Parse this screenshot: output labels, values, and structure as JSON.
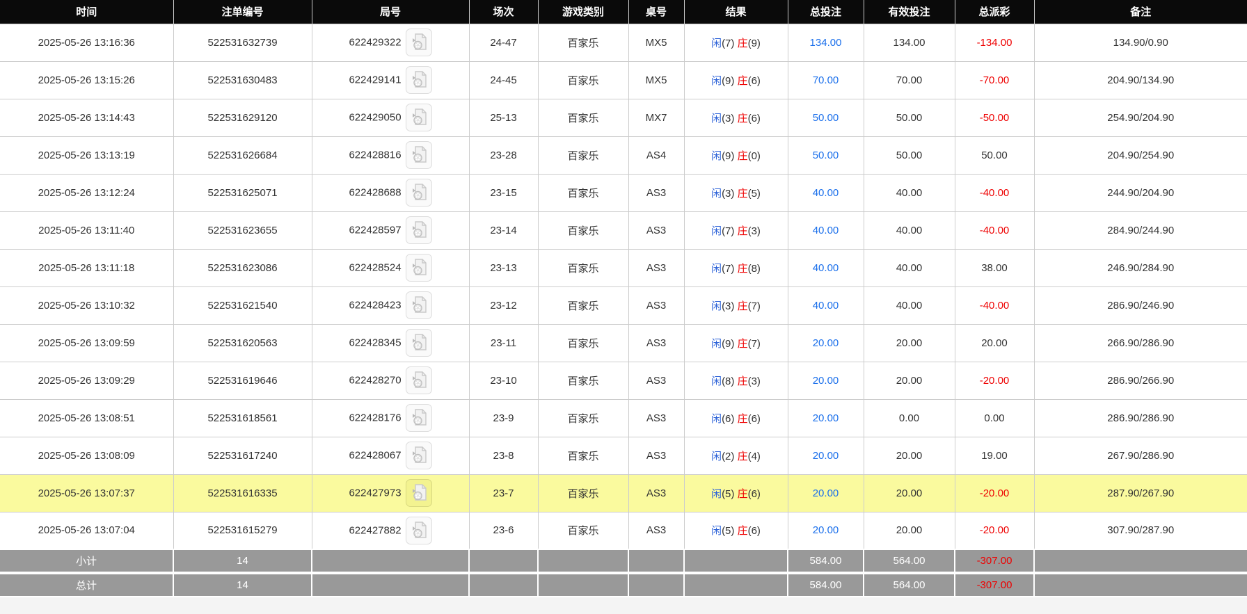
{
  "colors": {
    "header_bg": "#0a0a0a",
    "header_text": "#ffffff",
    "grid_border": "#cccccc",
    "row_text": "#333333",
    "bet_link_blue": "#1a6feb",
    "player_blue": "#2e63d8",
    "banker_red": "#ee0000",
    "negative_red": "#ee0000",
    "highlight_yellow": "#fafa9e",
    "summary_bg": "#999999"
  },
  "table": {
    "columns": [
      "时间",
      "注单编号",
      "局号",
      "场次",
      "游戏类别",
      "桌号",
      "结果",
      "总投注",
      "有效投注",
      "总派彩",
      "备注"
    ],
    "video_icon_name": "film-replay-icon",
    "rows": [
      {
        "time": "2025-05-26 13:16:36",
        "bet_no": "522531632739",
        "round_no": "622429322",
        "session": "24-47",
        "game": "百家乐",
        "table_no": "MX5",
        "result_player": "闲",
        "result_player_score": "(7)",
        "result_banker": "庄",
        "result_banker_score": "(9)",
        "total_bet": "134.00",
        "valid_bet": "134.00",
        "payout": "-134.00",
        "remark": "134.90/0.90",
        "highlighted": false
      },
      {
        "time": "2025-05-26 13:15:26",
        "bet_no": "522531630483",
        "round_no": "622429141",
        "session": "24-45",
        "game": "百家乐",
        "table_no": "MX5",
        "result_player": "闲",
        "result_player_score": "(9)",
        "result_banker": "庄",
        "result_banker_score": "(6)",
        "total_bet": "70.00",
        "valid_bet": "70.00",
        "payout": "-70.00",
        "remark": "204.90/134.90",
        "highlighted": false
      },
      {
        "time": "2025-05-26 13:14:43",
        "bet_no": "522531629120",
        "round_no": "622429050",
        "session": "25-13",
        "game": "百家乐",
        "table_no": "MX7",
        "result_player": "闲",
        "result_player_score": "(3)",
        "result_banker": "庄",
        "result_banker_score": "(6)",
        "total_bet": "50.00",
        "valid_bet": "50.00",
        "payout": "-50.00",
        "remark": "254.90/204.90",
        "highlighted": false
      },
      {
        "time": "2025-05-26 13:13:19",
        "bet_no": "522531626684",
        "round_no": "622428816",
        "session": "23-28",
        "game": "百家乐",
        "table_no": "AS4",
        "result_player": "闲",
        "result_player_score": "(9)",
        "result_banker": "庄",
        "result_banker_score": "(0)",
        "total_bet": "50.00",
        "valid_bet": "50.00",
        "payout": "50.00",
        "remark": "204.90/254.90",
        "highlighted": false
      },
      {
        "time": "2025-05-26 13:12:24",
        "bet_no": "522531625071",
        "round_no": "622428688",
        "session": "23-15",
        "game": "百家乐",
        "table_no": "AS3",
        "result_player": "闲",
        "result_player_score": "(3)",
        "result_banker": "庄",
        "result_banker_score": "(5)",
        "total_bet": "40.00",
        "valid_bet": "40.00",
        "payout": "-40.00",
        "remark": "244.90/204.90",
        "highlighted": false
      },
      {
        "time": "2025-05-26 13:11:40",
        "bet_no": "522531623655",
        "round_no": "622428597",
        "session": "23-14",
        "game": "百家乐",
        "table_no": "AS3",
        "result_player": "闲",
        "result_player_score": "(7)",
        "result_banker": "庄",
        "result_banker_score": "(3)",
        "total_bet": "40.00",
        "valid_bet": "40.00",
        "payout": "-40.00",
        "remark": "284.90/244.90",
        "highlighted": false
      },
      {
        "time": "2025-05-26 13:11:18",
        "bet_no": "522531623086",
        "round_no": "622428524",
        "session": "23-13",
        "game": "百家乐",
        "table_no": "AS3",
        "result_player": "闲",
        "result_player_score": "(7)",
        "result_banker": "庄",
        "result_banker_score": "(8)",
        "total_bet": "40.00",
        "valid_bet": "40.00",
        "payout": "38.00",
        "remark": "246.90/284.90",
        "highlighted": false
      },
      {
        "time": "2025-05-26 13:10:32",
        "bet_no": "522531621540",
        "round_no": "622428423",
        "session": "23-12",
        "game": "百家乐",
        "table_no": "AS3",
        "result_player": "闲",
        "result_player_score": "(3)",
        "result_banker": "庄",
        "result_banker_score": "(7)",
        "total_bet": "40.00",
        "valid_bet": "40.00",
        "payout": "-40.00",
        "remark": "286.90/246.90",
        "highlighted": false
      },
      {
        "time": "2025-05-26 13:09:59",
        "bet_no": "522531620563",
        "round_no": "622428345",
        "session": "23-11",
        "game": "百家乐",
        "table_no": "AS3",
        "result_player": "闲",
        "result_player_score": "(9)",
        "result_banker": "庄",
        "result_banker_score": "(7)",
        "total_bet": "20.00",
        "valid_bet": "20.00",
        "payout": "20.00",
        "remark": "266.90/286.90",
        "highlighted": false
      },
      {
        "time": "2025-05-26 13:09:29",
        "bet_no": "522531619646",
        "round_no": "622428270",
        "session": "23-10",
        "game": "百家乐",
        "table_no": "AS3",
        "result_player": "闲",
        "result_player_score": "(8)",
        "result_banker": "庄",
        "result_banker_score": "(3)",
        "total_bet": "20.00",
        "valid_bet": "20.00",
        "payout": "-20.00",
        "remark": "286.90/266.90",
        "highlighted": false
      },
      {
        "time": "2025-05-26 13:08:51",
        "bet_no": "522531618561",
        "round_no": "622428176",
        "session": "23-9",
        "game": "百家乐",
        "table_no": "AS3",
        "result_player": "闲",
        "result_player_score": "(6)",
        "result_banker": "庄",
        "result_banker_score": "(6)",
        "total_bet": "20.00",
        "valid_bet": "0.00",
        "payout": "0.00",
        "remark": "286.90/286.90",
        "highlighted": false
      },
      {
        "time": "2025-05-26 13:08:09",
        "bet_no": "522531617240",
        "round_no": "622428067",
        "session": "23-8",
        "game": "百家乐",
        "table_no": "AS3",
        "result_player": "闲",
        "result_player_score": "(2)",
        "result_banker": "庄",
        "result_banker_score": "(4)",
        "total_bet": "20.00",
        "valid_bet": "20.00",
        "payout": "19.00",
        "remark": "267.90/286.90",
        "highlighted": false
      },
      {
        "time": "2025-05-26 13:07:37",
        "bet_no": "522531616335",
        "round_no": "622427973",
        "session": "23-7",
        "game": "百家乐",
        "table_no": "AS3",
        "result_player": "闲",
        "result_player_score": "(5)",
        "result_banker": "庄",
        "result_banker_score": "(6)",
        "total_bet": "20.00",
        "valid_bet": "20.00",
        "payout": "-20.00",
        "remark": "287.90/267.90",
        "highlighted": true
      },
      {
        "time": "2025-05-26 13:07:04",
        "bet_no": "522531615279",
        "round_no": "622427882",
        "session": "23-6",
        "game": "百家乐",
        "table_no": "AS3",
        "result_player": "闲",
        "result_player_score": "(5)",
        "result_banker": "庄",
        "result_banker_score": "(6)",
        "total_bet": "20.00",
        "valid_bet": "20.00",
        "payout": "-20.00",
        "remark": "307.90/287.90",
        "highlighted": false
      }
    ],
    "summary": {
      "subtotal": {
        "label": "小计",
        "count": "14",
        "total_bet": "584.00",
        "valid_bet": "564.00",
        "payout": "-307.00"
      },
      "total": {
        "label": "总计",
        "count": "14",
        "total_bet": "584.00",
        "valid_bet": "564.00",
        "payout": "-307.00"
      }
    }
  }
}
